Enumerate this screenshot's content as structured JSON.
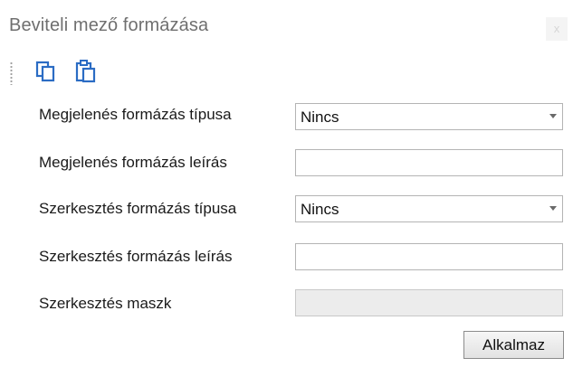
{
  "window": {
    "title": "Beviteli mező formázása",
    "close_label": "x"
  },
  "toolbar": {
    "buttons": [
      {
        "icon": "copy-icon"
      },
      {
        "icon": "paste-icon"
      }
    ],
    "icon_color": "#2b6cc4"
  },
  "form": {
    "display_format_type": {
      "label": "Megjelenés formázás típusa",
      "value": "Nincs"
    },
    "display_format_string": {
      "label": "Megjelenés formázás leírás",
      "value": ""
    },
    "edit_format_type": {
      "label": "Szerkesztés formázás típusa",
      "value": "Nincs"
    },
    "edit_format_string": {
      "label": "Szerkesztés formázás leírás",
      "value": ""
    },
    "edit_mask": {
      "label": "Szerkesztés maszk",
      "value": ""
    },
    "apply_label": "Alkalmaz"
  }
}
